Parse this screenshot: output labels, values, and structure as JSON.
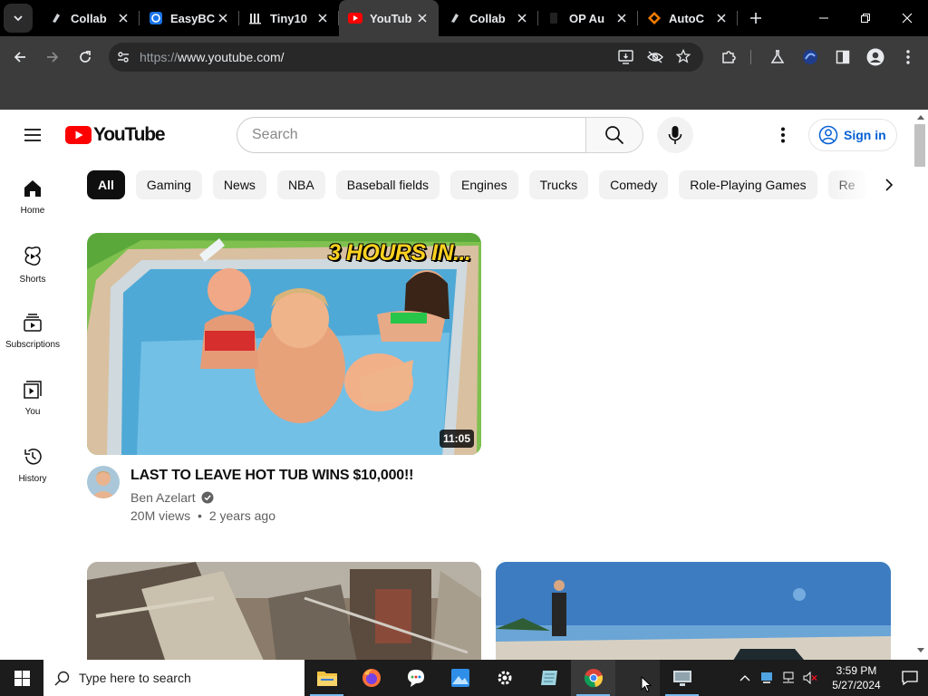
{
  "browser": {
    "tabs": [
      {
        "title": "Collab",
        "icon": "collab-icon"
      },
      {
        "title": "EasyBC",
        "icon": "easybc-icon"
      },
      {
        "title": "Tiny10",
        "icon": "tiny10-icon"
      },
      {
        "title": "YouTub",
        "icon": "youtube-icon",
        "active": true
      },
      {
        "title": "Collab",
        "icon": "collab-icon"
      },
      {
        "title": "OP Au",
        "icon": "blank-icon"
      },
      {
        "title": "AutoC",
        "icon": "autoc-icon"
      }
    ],
    "url_scheme": "https://",
    "url_host": "www.youtube.com/"
  },
  "youtube": {
    "logo_text": "YouTube",
    "search_placeholder": "Search",
    "sign_in_label": "Sign in",
    "sidebar": [
      {
        "label": "Home",
        "icon": "home-icon"
      },
      {
        "label": "Shorts",
        "icon": "shorts-icon"
      },
      {
        "label": "Subscriptions",
        "icon": "subscriptions-icon"
      },
      {
        "label": "You",
        "icon": "you-icon"
      },
      {
        "label": "History",
        "icon": "history-icon"
      }
    ],
    "chips": [
      "All",
      "Gaming",
      "News",
      "NBA",
      "Baseball fields",
      "Engines",
      "Trucks",
      "Comedy",
      "Role-Playing Games",
      "Re"
    ],
    "videos": [
      {
        "title": "LAST TO LEAVE HOT TUB WINS $10,000!!",
        "channel": "Ben Azelart",
        "views": "20M views",
        "age": "2 years ago",
        "duration": "11:05",
        "thumbnail_text": "3 HOURS IN..."
      }
    ]
  },
  "taskbar": {
    "search_placeholder": "Type here to search",
    "time": "3:59 PM",
    "date": "5/27/2024"
  },
  "colors": {
    "youtube_red": "#ff0000",
    "chrome_dark": "#3c3c3c",
    "link_blue": "#065fd4",
    "taskbar": "#1c1c1c"
  }
}
